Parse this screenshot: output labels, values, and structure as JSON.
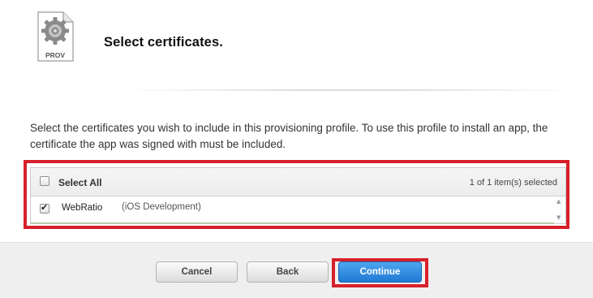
{
  "header": {
    "title": "Select certificates.",
    "icon": {
      "name": "provisioning-profile-icon",
      "label": "PROV"
    }
  },
  "description": "Select the certificates you wish to include in this provisioning profile. To use this profile to install an app, the certificate the app was signed with must be included.",
  "certificates": {
    "select_all_label": "Select All",
    "select_all_checked": false,
    "selected_count": "1 of 1 item(s) selected",
    "items": [
      {
        "name": "WebRatio",
        "type": "(iOS Development)",
        "checked": true
      }
    ]
  },
  "footer": {
    "cancel_label": "Cancel",
    "back_label": "Back",
    "continue_label": "Continue"
  },
  "colors": {
    "highlight": "#d6202a",
    "primary_button": "#1f79d4",
    "row_border": "#9ecf89"
  }
}
